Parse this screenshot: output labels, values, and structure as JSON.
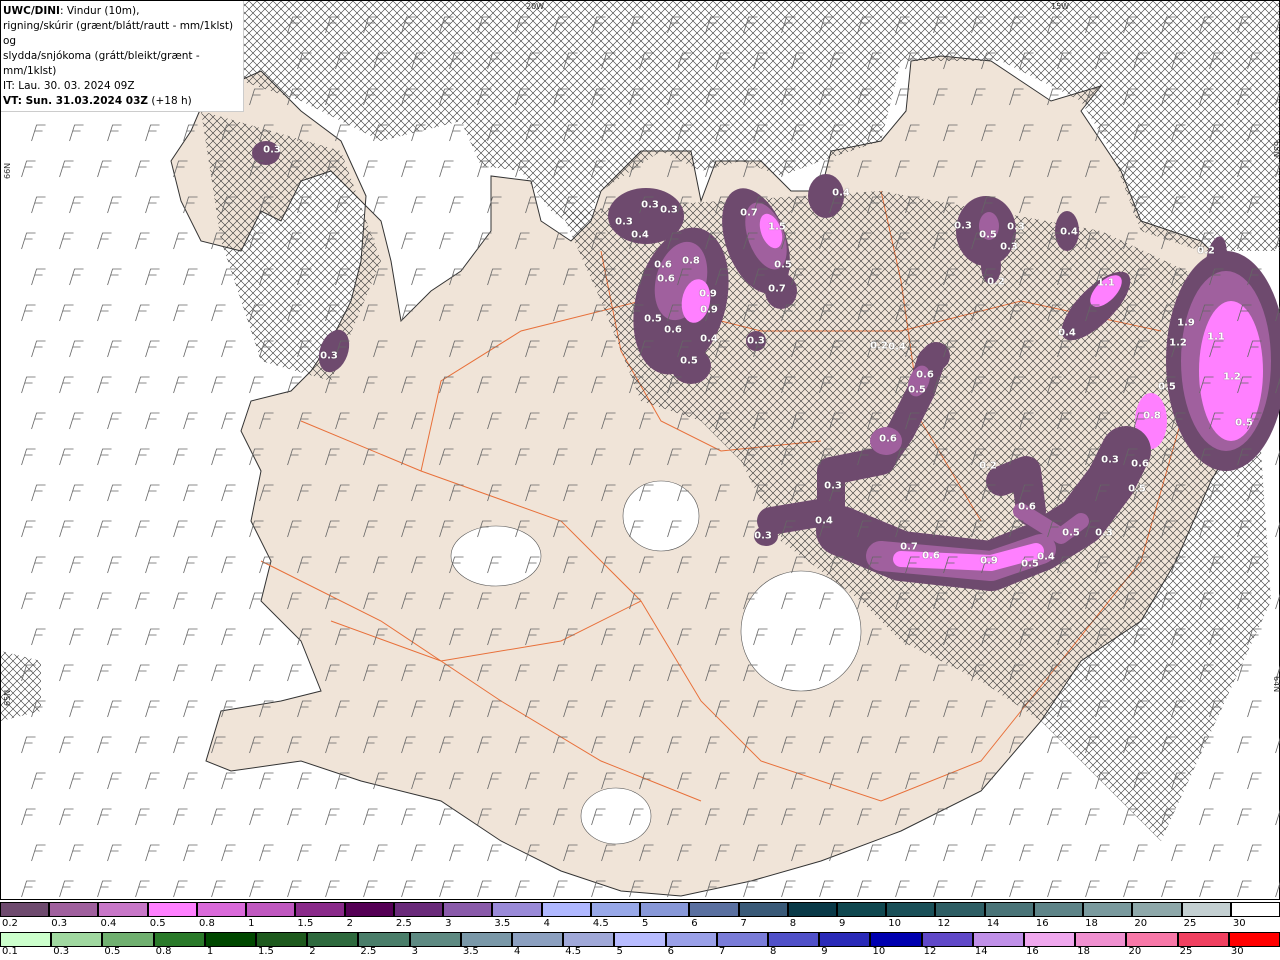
{
  "header": {
    "model": "UWC/DINI",
    "line1_rest": ": Vindur (10m),",
    "line2": "rigning/skúrir (grænt/blátt/rautt - mm/1klst) og",
    "line3": "slydda/snjókoma (grátt/bleikt/grænt - mm/1klst)",
    "init_time": "IT: Lau. 30. 03. 2024 09Z",
    "valid_label": "VT: Sun. 31.03.2024 03Z",
    "lead": "(+18 h)"
  },
  "grid_labels": {
    "lon_20w": "20W",
    "lon_15w": "15W",
    "lat_left_top": "66N",
    "lat_left_bottom": "65N",
    "lat_right_top": "65N",
    "lat_right_bottom": "64N"
  },
  "precip_values": [
    "0.3",
    "0.3",
    "0.3",
    "0.3",
    "0.3",
    "0.4",
    "0.6",
    "0.8",
    "0.6",
    "0.9",
    "0.9",
    "0.5",
    "0.6",
    "0.4",
    "0.5",
    "0.3",
    "0.7",
    "1.5",
    "0.5",
    "0.7",
    "0.4",
    "0.3",
    "0.5",
    "0.3",
    "0.3",
    "0.2",
    "0.4",
    "1.1",
    "0.4",
    "0.2",
    "1.9",
    "1.2",
    "1.1",
    "1.2",
    "0.5",
    "0.8",
    "0.5",
    "0.2",
    "0.4",
    "0.6",
    "0.5",
    "0.6",
    "0.2",
    "0.3",
    "0.6",
    "0.4",
    "0.3",
    "0.7",
    "0.6",
    "0.9",
    "0.5",
    "0.4",
    "0.5",
    "0.3",
    "0.3",
    "0.6",
    "0.5"
  ],
  "legend_snow": {
    "labels": [
      "0.2",
      "0.3",
      "0.4",
      "0.5",
      "0.8",
      "1",
      "1.5",
      "2",
      "2.5",
      "3",
      "3.5",
      "4",
      "4.5",
      "5",
      "6",
      "7",
      "8",
      "9",
      "10",
      "12",
      "14",
      "16",
      "18",
      "20",
      "25",
      "30"
    ],
    "colors": [
      "#6e4a6e",
      "#a0609e",
      "#c877c8",
      "#ff80ff",
      "#da6ada",
      "#c058c0",
      "#8a2a8a",
      "#550055",
      "#6a2a7a",
      "#8a5aaa",
      "#9a8ad8",
      "#b0b8ff",
      "#98a8e8",
      "#8898d8",
      "#5a70a0",
      "#3a5a78",
      "#0a3a48",
      "#104850",
      "#1a5058",
      "#2e5e64",
      "#4a7478",
      "#5e8488",
      "#7a9a9e",
      "#8ea8aa",
      "#c4d0d2",
      "#ffffff"
    ]
  },
  "legend_rain": {
    "labels": [
      "0.1",
      "0.3",
      "0.5",
      "0.8",
      "1",
      "1.5",
      "2",
      "2.5",
      "3",
      "3.5",
      "4",
      "4.5",
      "5",
      "6",
      "7",
      "8",
      "9",
      "10",
      "12",
      "14",
      "16",
      "18",
      "20",
      "25",
      "30"
    ],
    "colors": [
      "#ccffcc",
      "#a0d8a0",
      "#70b070",
      "#2a7a2a",
      "#004800",
      "#1e5a1e",
      "#2e6a3e",
      "#4a7e6a",
      "#5e8a82",
      "#7a98a8",
      "#8ca0c0",
      "#a0a8d8",
      "#b8bcff",
      "#9aa0e8",
      "#7a7cd8",
      "#5050c8",
      "#2a2ab8",
      "#0000b0",
      "#6048c8",
      "#c090e8",
      "#f0a8ee",
      "#f090d0",
      "#f878a8",
      "#f04060",
      "#ff0000"
    ]
  },
  "colors": {
    "land": "#f0e4d8",
    "road": "#e8703a",
    "precip_dark": "#6e4a6e",
    "precip_mid": "#a0609e",
    "precip_light": "#ff80ff"
  }
}
